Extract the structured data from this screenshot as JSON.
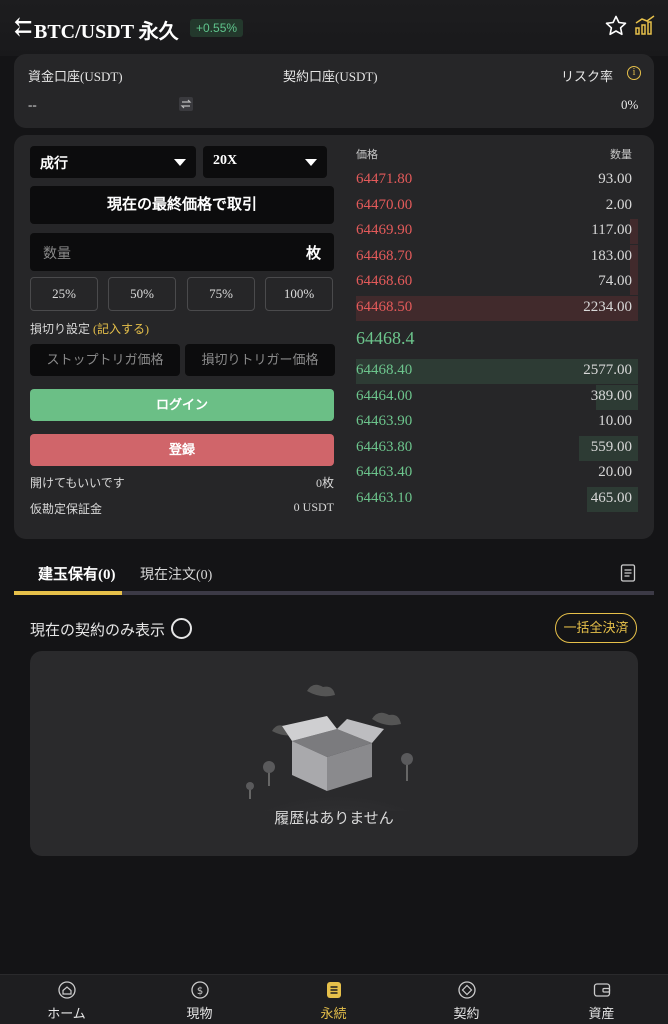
{
  "header": {
    "back_icon": "back-arrow-icon",
    "pair": "BTC/USDT 永久",
    "change": "+0.55%",
    "colors": {
      "positive": "#5fc48c"
    }
  },
  "account": {
    "fund_label": "資金口座(USDT)",
    "contract_label": "契約口座(USDT)",
    "risk_label": "リスク率",
    "fund_value": "--",
    "risk_value": "0%"
  },
  "order": {
    "type": "成行",
    "leverage": "20X",
    "market_btn": "現在の最終価格で取引",
    "qty_placeholder": "数量",
    "qty_unit": "枚",
    "percents": [
      "25%",
      "50%",
      "75%",
      "100%"
    ],
    "stoploss_label": "損切り設定",
    "stoploss_link": "(記入する)",
    "trig1_placeholder": "ストップトリガ価格",
    "trig2_placeholder": "損切りトリガー価格",
    "login": "ログイン",
    "register": "登録",
    "openable_label": "開けてもいいです",
    "openable_value": "0枚",
    "margin_label": "仮勘定保証金",
    "margin_value": "0 USDT"
  },
  "orderbook": {
    "price_header": "価格",
    "qty_header": "数量",
    "asks": [
      {
        "price": "64471.80",
        "qty": "93.00",
        "depth": 0.0
      },
      {
        "price": "64470.00",
        "qty": "2.00",
        "depth": 0.0
      },
      {
        "price": "64469.90",
        "qty": "117.00",
        "depth": 0.03
      },
      {
        "price": "64468.70",
        "qty": "183.00",
        "depth": 0.03
      },
      {
        "price": "64468.60",
        "qty": "74.00",
        "depth": 0.03
      },
      {
        "price": "64468.50",
        "qty": "2234.00",
        "depth": 1.0
      }
    ],
    "last_price": "64468.4",
    "bids": [
      {
        "price": "64468.40",
        "qty": "2577.00",
        "depth": 1.0
      },
      {
        "price": "64464.00",
        "qty": "389.00",
        "depth": 0.15
      },
      {
        "price": "64463.90",
        "qty": "10.00",
        "depth": 0.0
      },
      {
        "price": "64463.80",
        "qty": "559.00",
        "depth": 0.21
      },
      {
        "price": "64463.40",
        "qty": "20.00",
        "depth": 0.0
      },
      {
        "price": "64463.10",
        "qty": "465.00",
        "depth": 0.18
      }
    ]
  },
  "positions": {
    "tab1": "建玉保有(0)",
    "tab2": "現在注文(0)",
    "filter_label": "現在の契約のみ表示",
    "close_all": "一括全決済",
    "empty_text": "履歴はありません"
  },
  "nav": [
    {
      "label": "ホーム",
      "icon": "home-icon"
    },
    {
      "label": "現物",
      "icon": "coin-icon"
    },
    {
      "label": "永続",
      "icon": "document-icon"
    },
    {
      "label": "契約",
      "icon": "contract-icon"
    },
    {
      "label": "資産",
      "icon": "wallet-icon"
    }
  ],
  "colors": {
    "accent": "#e6c04a",
    "buy": "#6bbf86",
    "sell": "#d0656a"
  }
}
